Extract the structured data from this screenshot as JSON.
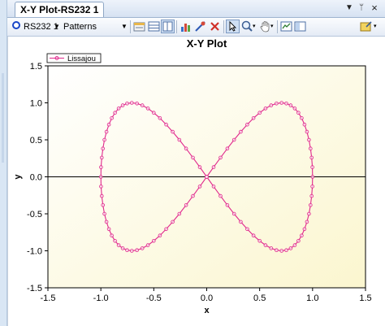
{
  "window": {
    "tab_title": "X-Y Plot-RS232 1",
    "tab_controls": {
      "dropdown": "▼",
      "pin": "ᛘ",
      "close": "×"
    }
  },
  "toolbar": {
    "device_label": "RS232 1",
    "device_chevron": "▼",
    "view_label": "Patterns",
    "view_chevron": "▼",
    "buttons": [
      "properties-icon",
      "table-icon",
      "columns-icon",
      "chart-icon",
      "probe-icon",
      "clear-icon",
      "cursor-icon",
      "zoom-icon",
      "pan-icon",
      "export-icon",
      "settings-icon"
    ]
  },
  "colors": {
    "series": "#e0288c",
    "plot_bg_light": "#ffffff",
    "plot_bg_warm": "#fbf6cf",
    "accent_blue": "#1846c8"
  },
  "chart_data": {
    "type": "scatter",
    "title": "X-Y Plot",
    "xlabel": "x",
    "ylabel": "y",
    "xlim": [
      -1.5,
      1.5
    ],
    "ylim": [
      -1.5,
      1.5
    ],
    "xticks": [
      "-1.5",
      "-1.0",
      "-0.5",
      "0.0",
      "0.5",
      "1.0",
      "1.5"
    ],
    "yticks": [
      "1.5",
      "1.0",
      "0.5",
      "0.0",
      "-0.5",
      "-1.0",
      "-1.5"
    ],
    "legend": "top-left",
    "grid": false,
    "zero_line_y": 0,
    "series": [
      {
        "name": "Lissajou",
        "marker": "circle",
        "curve": "lissajous",
        "x_function": "sin(t)",
        "y_function": "sin(2t)",
        "points": 96
      }
    ]
  }
}
